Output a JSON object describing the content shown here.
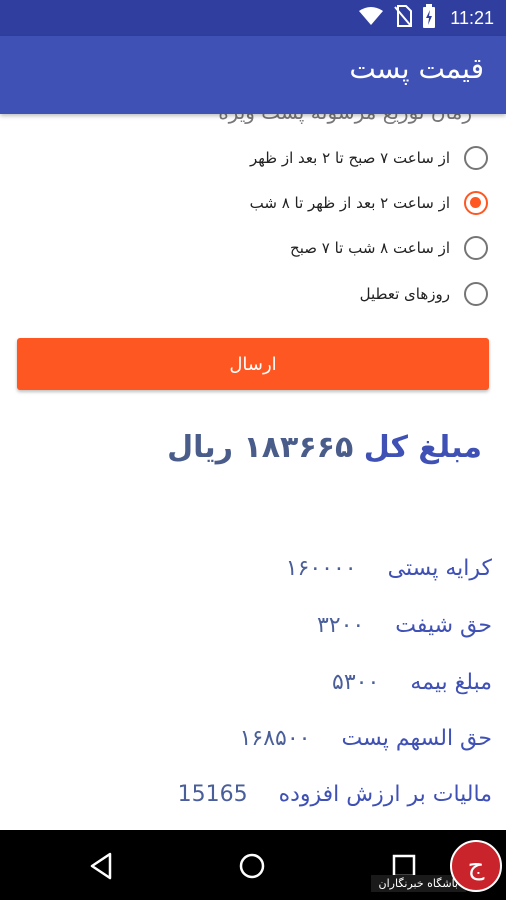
{
  "status_bar": {
    "time": "11:21"
  },
  "app_bar": {
    "title": "قیمت پست"
  },
  "delivery": {
    "section_title": "زمان توزیع مرسوله پست ویژه",
    "options": [
      {
        "label": "از ساعت ۷ صبح تا ۲ بعد از ظهر",
        "checked": false
      },
      {
        "label": "از ساعت ۲ بعد از ظهر تا ۸ شب",
        "checked": true
      },
      {
        "label": "از ساعت ۸ شب تا ۷ صبح",
        "checked": false
      },
      {
        "label": "روزهای تعطیل",
        "checked": false
      }
    ],
    "submit_label": "ارسال"
  },
  "results": {
    "total_label": "مبلغ کل",
    "total_amount": "۱۸۳۶۶۵",
    "total_unit": "ریال",
    "rows": [
      {
        "label": "کرایه پستی",
        "value": "۱۶۰۰۰۰"
      },
      {
        "label": "حق شیفت",
        "value": "۳۲۰۰"
      },
      {
        "label": "مبلغ بیمه",
        "value": "۵۳۰۰"
      },
      {
        "label": "حق السهم پست",
        "value": "۱۶۸۵۰۰"
      },
      {
        "label": "مالیات بر ارزش افزوده",
        "value": "15165"
      }
    ]
  },
  "watermark": {
    "text": "باشگاه خبرنگاران",
    "logo_letter": "ج"
  },
  "colors": {
    "primary": "#3f51b5",
    "primary_dark": "#303f9f",
    "accent": "#ff5722"
  }
}
